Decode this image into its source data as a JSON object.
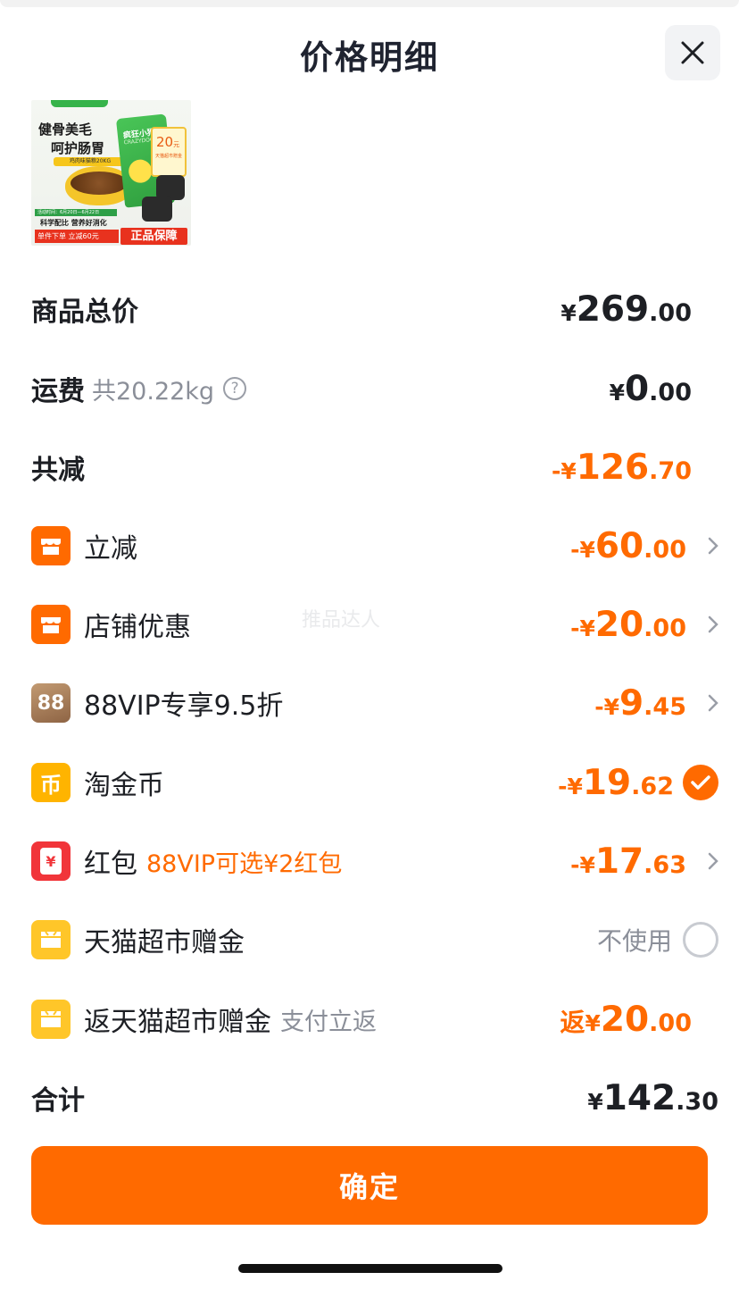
{
  "title": "价格明细",
  "close_label": "关闭",
  "product": {
    "slogan_line1": "健骨美毛",
    "slogan_line2": "呵护肠胃",
    "pill_text": "鸡肉味猫粮20KG",
    "bag_brand": "疯狂小狗",
    "bag_sub": "CRAZYDOG",
    "card_number": "20",
    "card_unit": "元",
    "card_sub": "天猫超市赠金",
    "activity_text": "活动时间：6月20日—6月22日",
    "feature_text": "科学配比 营养好消化",
    "promo_text": "单件下单 立减60元",
    "authentic_text": "正品保障"
  },
  "summary": {
    "total_label": "商品总价",
    "total_yen": "¥",
    "total_int": "269",
    "total_dec": ".00",
    "shipping_label": "运费",
    "shipping_weight": "共20.22kg",
    "shipping_help": "?",
    "shipping_yen": "¥",
    "shipping_int": "0",
    "shipping_dec": ".00",
    "discount_label": "共减",
    "discount_sign": "-",
    "discount_yen": "¥",
    "discount_int": "126",
    "discount_dec": ".70"
  },
  "discounts": [
    {
      "label": "立减",
      "icon": "shop-icon",
      "sign": "-",
      "yen": "¥",
      "int": "60",
      "dec": ".00"
    },
    {
      "label": "店铺优惠",
      "icon": "shop-icon",
      "sign": "-",
      "yen": "¥",
      "int": "20",
      "dec": ".00"
    },
    {
      "label": "88VIP专享9.5折",
      "icon": "88vip-icon",
      "icon_text": "88",
      "sign": "-",
      "yen": "¥",
      "int": "9",
      "dec": ".45"
    },
    {
      "label": "淘金币",
      "icon": "coin-icon",
      "icon_text": "币",
      "sign": "-",
      "yen": "¥",
      "int": "19",
      "dec": ".62"
    },
    {
      "label": "红包",
      "hint": "88VIP可选¥2红包",
      "icon": "red-packet-icon",
      "icon_text": "¥",
      "sign": "-",
      "yen": "¥",
      "int": "17",
      "dec": ".63"
    },
    {
      "label": "天猫超市赠金",
      "icon": "tmall-gift-icon",
      "status": "不使用"
    },
    {
      "label": "返天猫超市赠金",
      "hint": "支付立返",
      "icon": "tmall-gift-icon",
      "prefix": "返",
      "yen": "¥",
      "int": "20",
      "dec": ".00"
    }
  ],
  "total": {
    "label": "合计",
    "yen": "¥",
    "int": "142",
    "dec": ".30"
  },
  "watermark": "推品达人",
  "confirm_label": "确定",
  "colors": {
    "accent": "#ff6a00",
    "text": "#1d1f24",
    "muted": "#8b8f99",
    "vip": "#a9805a",
    "coin": "#ffb400",
    "red_packet": "#f1353a",
    "gift": "#ffc629"
  }
}
